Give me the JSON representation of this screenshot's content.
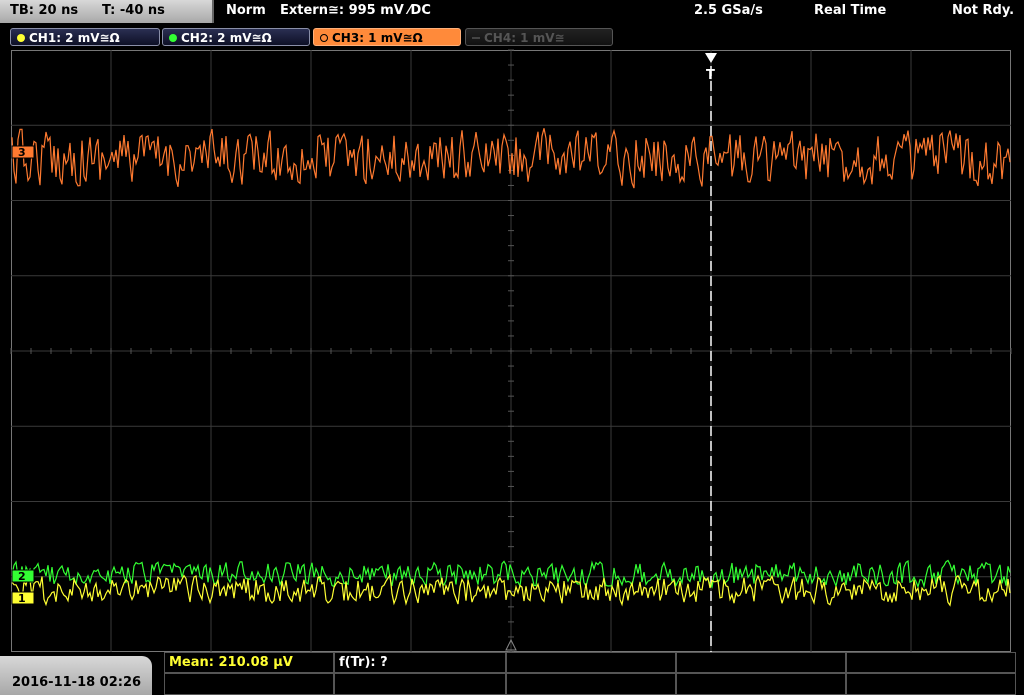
{
  "header": {
    "timebase": "TB: 20 ns",
    "trigger_time": "T: -40 ns",
    "mode": "Norm",
    "trigger_source": "Extern≅: 995 mV ⁄DC",
    "sample_rate": "2.5 GSa/s",
    "acquisition": "Real Time",
    "status": "Not Rdy."
  },
  "channels": [
    {
      "label": "CH1: 2 mV≅Ω",
      "color": "#ffff33",
      "state": "on"
    },
    {
      "label": "CH2: 2 mV≅Ω",
      "color": "#33ff33",
      "state": "on"
    },
    {
      "label": "CH3: 1 mV≅Ω",
      "color": "#ff8a3a",
      "state": "active"
    },
    {
      "label": "CH4: 1 mV≅",
      "color": "#555555",
      "state": "off"
    }
  ],
  "markers": {
    "trigger_marker": "T",
    "ch3_marker": "3",
    "ch2_marker": "2",
    "ch1_marker": "1"
  },
  "colors": {
    "ch1": "#ffff33",
    "ch2": "#33ff33",
    "ch3": "#ff7a30",
    "grid": "#3a3a3a",
    "trigger_line": "#ffffff"
  },
  "measurements": {
    "mean": "Mean: 210.08 µV",
    "frequency": "f(Tr): ?"
  },
  "footer": {
    "datetime": "2016-11-18 02:26"
  }
}
